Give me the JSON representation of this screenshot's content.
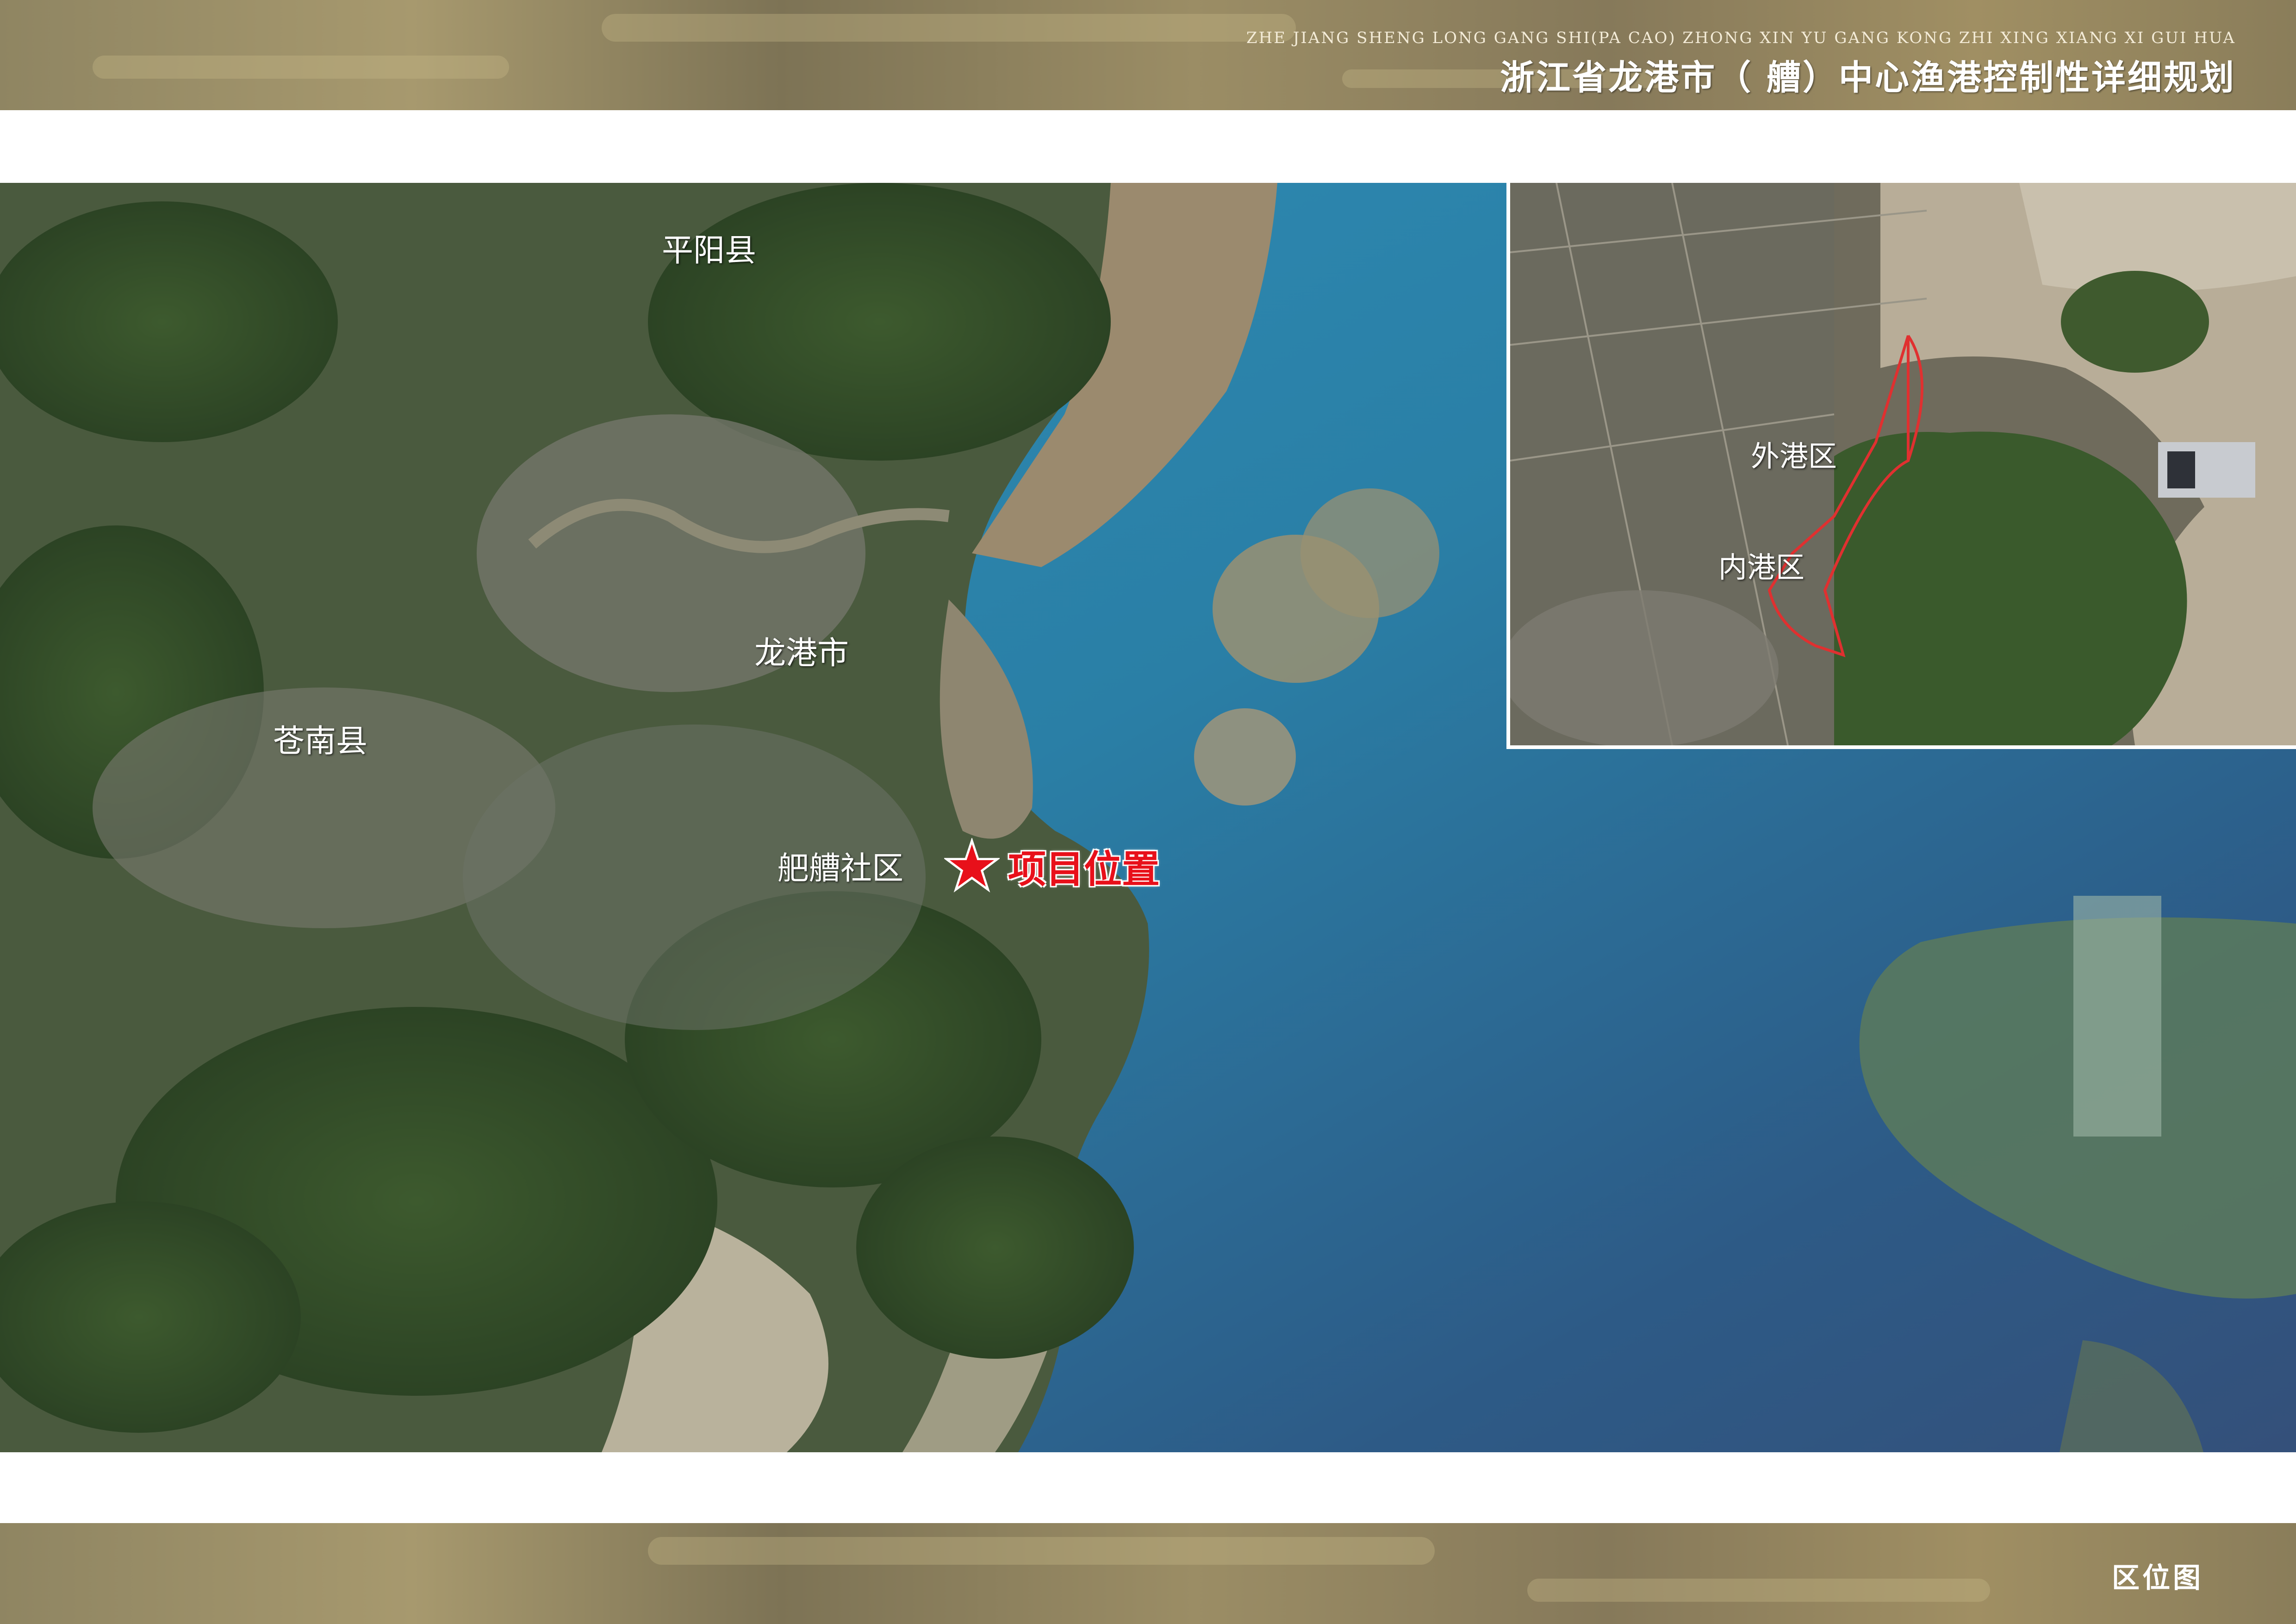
{
  "header": {
    "subtitle": "ZHE JIANG SHENG LONG GANG SHI(PA CAO) ZHONG XIN YU GANG KONG ZHI XING XIANG XI GUI HUA",
    "title": "浙江省龙港市（  艚）中心渔港控制性详细规划"
  },
  "footer": {
    "title": "区位图"
  },
  "map": {
    "labels": {
      "pingyang": "平阳县",
      "longgang": "龙港市",
      "cangnan": "苍南县",
      "pacao": "舥艚社区"
    },
    "project_marker": {
      "icon": "star-icon",
      "label": "项目位置",
      "color": "#e8101a"
    },
    "inset": {
      "labels": {
        "outer_harbor": "外港区",
        "inner_harbor": "内港区"
      },
      "boundary_color": "#e03030"
    }
  }
}
